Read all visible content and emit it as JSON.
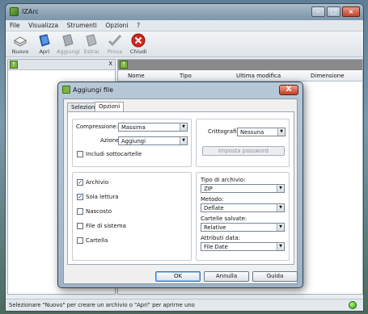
{
  "window": {
    "title": "IZArc"
  },
  "menu": [
    "File",
    "Visualizza",
    "Strumenti",
    "Opzioni",
    "?"
  ],
  "toolbar": [
    {
      "label": "Nuovo",
      "icon": "new-archive-icon",
      "enabled": true
    },
    {
      "label": "Apri",
      "icon": "open-folder-icon",
      "enabled": true
    },
    {
      "label": "Aggiungi",
      "icon": "add-files-icon",
      "enabled": false
    },
    {
      "label": "Estrai",
      "icon": "extract-icon",
      "enabled": false
    },
    {
      "label": "Prova",
      "icon": "test-check-icon",
      "enabled": false
    },
    {
      "label": "Chiudi",
      "icon": "close-icon",
      "enabled": true
    }
  ],
  "left_panel": {
    "close_mark": "X"
  },
  "columns": [
    "Nome",
    "Tipo",
    "Ultima modifica",
    "Dimensione"
  ],
  "status": {
    "text": "Selezionare \"Nuovo\" per creare un archivio o \"Apri\" per aprirne uno"
  },
  "dialog": {
    "title": "Aggiungi file",
    "close_symbol": "X",
    "tabs": [
      "Selezione",
      "Opzioni"
    ],
    "active_tab": "Opzioni",
    "compressione_label": "Compressione:",
    "compressione_value": "Massima",
    "azione_label": "Azione:",
    "azione_value": "Aggiungi",
    "includi_label": "Includi sottocartelle",
    "includi_checked": false,
    "crittografia_label": "Crittografia:",
    "crittografia_value": "Nessuna",
    "imposta_password_label": "Imposta password",
    "attributes": [
      {
        "label": "Archivio",
        "checked": true
      },
      {
        "label": "Sola lettura",
        "checked": true
      },
      {
        "label": "Nascosto",
        "checked": false
      },
      {
        "label": "File di sistema",
        "checked": false
      },
      {
        "label": "Cartella",
        "checked": false
      }
    ],
    "tipo_label": "Tipo di archivio:",
    "tipo_value": "ZIP",
    "metodo_label": "Metodo:",
    "metodo_value": "Deflate",
    "cartelle_label": "Cartelle salvate:",
    "cartelle_value": "Relative",
    "attributi_label": "Attributi data:",
    "attributi_value": "File Date",
    "ok_label": "OK",
    "annulla_label": "Annulla",
    "guida_label": "Guida"
  }
}
